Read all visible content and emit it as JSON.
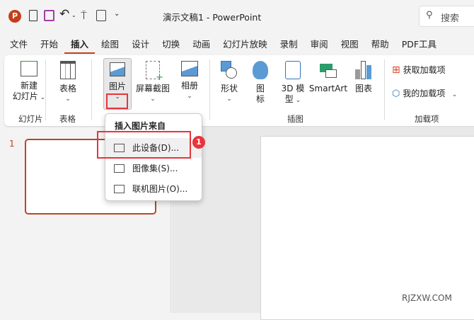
{
  "titlebar": {
    "title": "演示文稿1  -  PowerPoint",
    "search_placeholder": "搜索"
  },
  "tabs": [
    "文件",
    "开始",
    "插入",
    "绘图",
    "设计",
    "切换",
    "动画",
    "幻灯片放映",
    "录制",
    "审阅",
    "视图",
    "帮助",
    "PDF工具"
  ],
  "active_tab": "插入",
  "ribbon": {
    "new_slide": "新建\n幻灯片",
    "new_slide_l1": "新建",
    "new_slide_l2": "幻灯片",
    "table": "表格",
    "picture": "图片",
    "screenshot": "屏幕截图",
    "album": "相册",
    "shapes": "形状",
    "icons_l1": "图",
    "icons_l2": "标",
    "model_l1": "3D 模",
    "model_l2": "型",
    "smartart": "SmartArt",
    "chart": "图表",
    "get_addins": "获取加载项",
    "my_addins": "我的加载项",
    "groups": {
      "slides": "幻灯片",
      "tables": "表格",
      "illustrations": "插图",
      "addins": "加载项"
    }
  },
  "dropdown": {
    "header": "插入图片来自",
    "items": [
      "此设备(D)...",
      "图像集(S)...",
      "联机图片(O)..."
    ]
  },
  "annotation": {
    "step": "1"
  },
  "slide_panel": {
    "slide_number": "1"
  },
  "watermark": "RJZXW.COM",
  "colors": {
    "accent": "#c43e1c",
    "highlight": "#e8343a"
  }
}
